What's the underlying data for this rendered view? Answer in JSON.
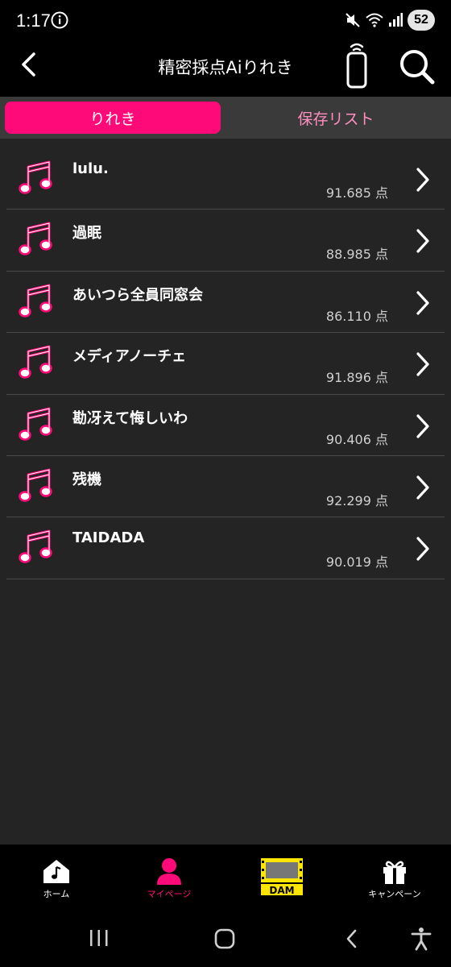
{
  "status_bar": {
    "time": "1:17",
    "battery": "52"
  },
  "header": {
    "title": "精密採点Aiりれき"
  },
  "tabs": [
    {
      "label": "りれき",
      "active": true
    },
    {
      "label": "保存リスト",
      "active": false
    }
  ],
  "history": [
    {
      "title": "lulu.",
      "score": "91.685 点"
    },
    {
      "title": "過眠",
      "score": "88.985 点"
    },
    {
      "title": "あいつら全員同窓会",
      "score": "86.110 点"
    },
    {
      "title": "メディアノーチェ",
      "score": "91.896 点"
    },
    {
      "title": "勘冴えて悔しいわ",
      "score": "90.406 点"
    },
    {
      "title": "残機",
      "score": "92.299 点"
    },
    {
      "title": "TAIDADA",
      "score": "90.019 点"
    }
  ],
  "bottom_nav": {
    "home": "ホーム",
    "mypage": "マイページ",
    "dam": "DAM",
    "campaign": "キャンペーン"
  },
  "colors": {
    "accent": "#ff0a78",
    "accent_light": "#ff8fc0",
    "background": "#242424",
    "dam_yellow": "#ffe600"
  }
}
